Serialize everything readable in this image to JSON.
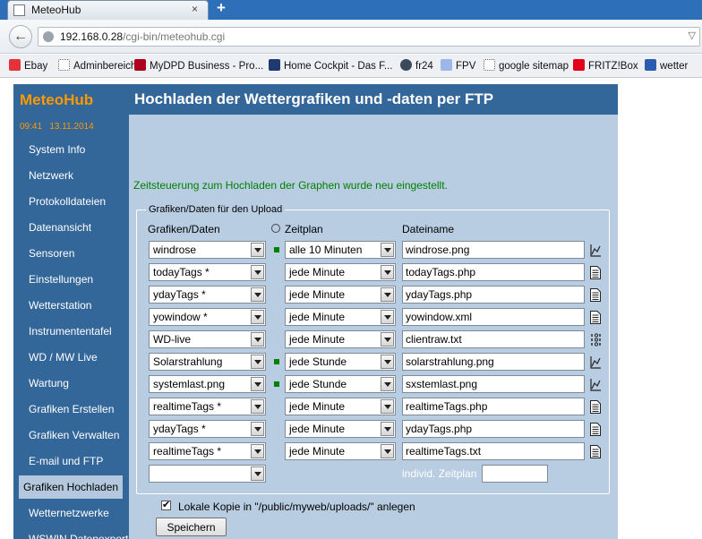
{
  "browser": {
    "tab_title": "MeteoHub",
    "tab_close": "×",
    "new_tab": "+",
    "url_host": "192.168.0.28",
    "url_path": "/cgi-bin/meteohub.cgi"
  },
  "bookmarks": [
    {
      "label": "Ebay",
      "icon": "ebay-icon",
      "color": "#e53238"
    },
    {
      "label": "Adminbereich",
      "icon": "page-icon",
      "color": "#ffffff"
    },
    {
      "label": "MyDPD Business - Pro...",
      "icon": "dpd-icon",
      "color": "#b00020"
    },
    {
      "label": "Home Cockpit - Das F...",
      "icon": "fli-icon",
      "color": "#1f3a70"
    },
    {
      "label": "fr24",
      "icon": "fr24-icon",
      "color": "#3b4a5a"
    },
    {
      "label": "FPV",
      "icon": "fpv-icon",
      "color": "#9bb8e8"
    },
    {
      "label": "google sitemap",
      "icon": "page-icon",
      "color": "#ffffff"
    },
    {
      "label": "FRITZ!Box",
      "icon": "fritzbox-icon",
      "color": "#e2001a"
    },
    {
      "label": "wetter",
      "icon": "w-icon",
      "color": "#2a5db0"
    }
  ],
  "sidebar": {
    "brand": "MeteoHub",
    "time": "09:41",
    "date": "13.11.2014",
    "items": [
      {
        "label": "System Info",
        "active": false
      },
      {
        "label": "Netzwerk",
        "active": false
      },
      {
        "label": "Protokolldateien",
        "active": false
      },
      {
        "label": "Datenansicht",
        "active": false
      },
      {
        "label": "Sensoren",
        "active": false
      },
      {
        "label": "Einstellungen",
        "active": false
      },
      {
        "label": "Wetterstation",
        "active": false
      },
      {
        "label": "Instrumententafel",
        "active": false
      },
      {
        "label": "WD / MW Live",
        "active": false
      },
      {
        "label": "Wartung",
        "active": false
      },
      {
        "label": "Grafiken Erstellen",
        "active": false
      },
      {
        "label": "Grafiken Verwalten",
        "active": false
      },
      {
        "label": "E-mail und FTP",
        "active": false
      },
      {
        "label": "Grafiken Hochladen",
        "active": true
      },
      {
        "label": "Wetternetzwerke",
        "active": false
      },
      {
        "label": "WSWIN Datenexport",
        "active": false
      }
    ]
  },
  "main": {
    "title": "Hochladen der Wettergrafiken und -daten per FTP",
    "status_message": "Zeitsteuerung zum Hochladen der Graphen wurde neu eingestellt.",
    "fieldset_legend": "Grafiken/Daten für den Upload",
    "col_type": "Grafiken/Daten",
    "col_schedule": "Zeitplan",
    "col_filename": "Dateiname",
    "rows": [
      {
        "type": "windrose",
        "schedule": "alle 10 Minuten",
        "filename": "windrose.png",
        "marker": true,
        "icon": "chart-icon"
      },
      {
        "type": "todayTags *",
        "schedule": "jede Minute",
        "filename": "todayTags.php",
        "marker": false,
        "icon": "document-icon"
      },
      {
        "type": "ydayTags *",
        "schedule": "jede Minute",
        "filename": "ydayTags.php",
        "marker": false,
        "icon": "document-icon"
      },
      {
        "type": "yowindow *",
        "schedule": "jede Minute",
        "filename": "yowindow.xml",
        "marker": false,
        "icon": "document-icon"
      },
      {
        "type": "WD-live",
        "schedule": "jede Minute",
        "filename": "clientraw.txt",
        "marker": false,
        "icon": "binary-icon"
      },
      {
        "type": "Solarstrahlung",
        "schedule": "jede Stunde",
        "filename": "solarstrahlung.png",
        "marker": true,
        "icon": "chart-icon"
      },
      {
        "type": "systemlast.png",
        "schedule": "jede Stunde",
        "filename": "sxstemlast.png",
        "marker": true,
        "icon": "chart-icon"
      },
      {
        "type": "realtimeTags *",
        "schedule": "jede Minute",
        "filename": "realtimeTags.php",
        "marker": false,
        "icon": "document-icon"
      },
      {
        "type": "ydayTags *",
        "schedule": "jede Minute",
        "filename": "ydayTags.php",
        "marker": false,
        "icon": "document-icon"
      },
      {
        "type": "realtimeTags *",
        "schedule": "jede Minute",
        "filename": "realtimeTags.txt",
        "marker": false,
        "icon": "document-icon"
      },
      {
        "type": "",
        "schedule": null,
        "filename": null,
        "marker": false,
        "icon": null
      }
    ],
    "individual_schedule_label": "individ. Zeitplan",
    "individual_schedule_value": "",
    "local_copy_checked": true,
    "local_copy_label": "Lokale Kopie in \"/public/myweb/uploads/\" anlegen",
    "save_label": "Speichern"
  },
  "colors": {
    "nav_blue": "#336699",
    "brand_orange": "#ff9900",
    "content_bg": "#b8cde2",
    "active_item_bg": "#b3c8dd",
    "status_green": "#008000"
  }
}
